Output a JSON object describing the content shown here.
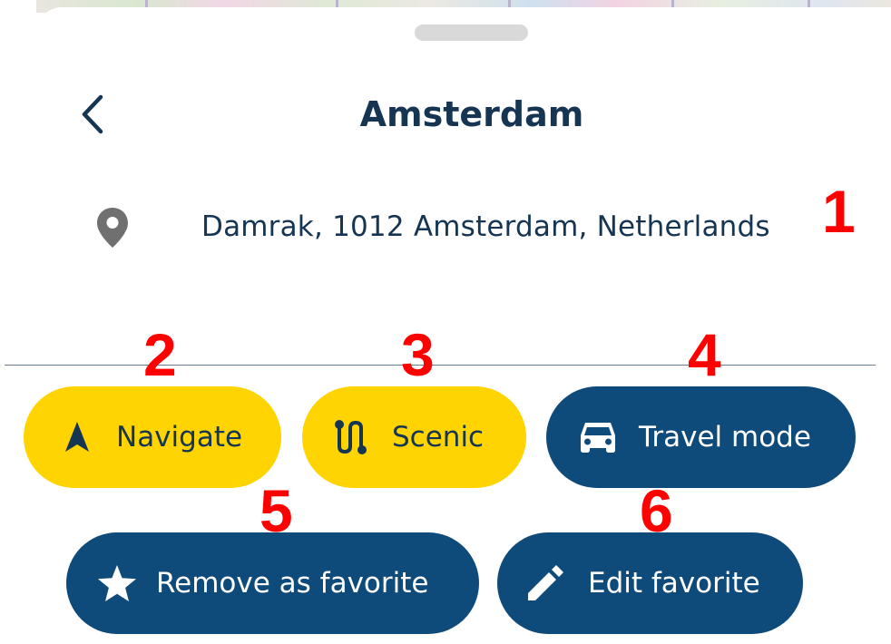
{
  "header": {
    "title": "Amsterdam",
    "back_icon": "chevron-left-icon"
  },
  "location": {
    "icon": "map-pin-icon",
    "address": "Damrak, 1012 Amsterdam, Netherlands"
  },
  "actions": {
    "navigate": {
      "label": "Navigate",
      "icon": "navigation-arrow-icon"
    },
    "scenic": {
      "label": "Scenic",
      "icon": "scenic-route-icon"
    },
    "travel_mode": {
      "label": "Travel mode",
      "icon": "car-icon"
    },
    "remove_favorite": {
      "label": "Remove as favorite",
      "icon": "star-icon"
    },
    "edit_favorite": {
      "label": "Edit favorite",
      "icon": "pencil-icon"
    }
  },
  "markers": [
    "1",
    "2",
    "3",
    "4",
    "5",
    "6"
  ],
  "colors": {
    "navy": "#153553",
    "button_blue": "#0e4a7a",
    "yellow": "#ffd400",
    "marker_red": "#ff0000",
    "pin_gray": "#707070"
  }
}
